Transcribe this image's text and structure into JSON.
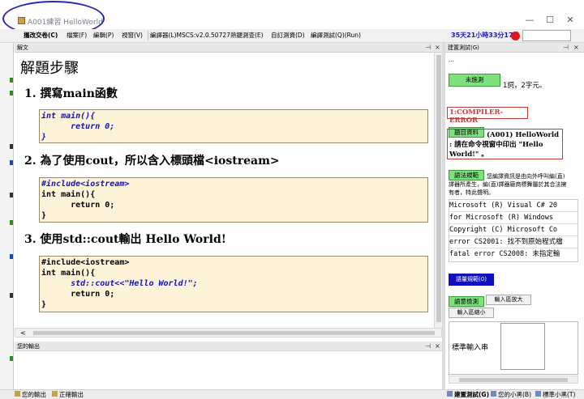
{
  "window": {
    "title": "A001練習 HelloWorld",
    "controls": [
      "—",
      "☐",
      "✕"
    ]
  },
  "menu": {
    "items": [
      "攜改交卷(C)",
      "檔案(F)",
      "編輯(P)",
      "視窗(V)",
      "編譯器(L)MSCS:v2.0.50727",
      "熱鍵測查(E)",
      "自訂測資(D)",
      "編譯測試(Q)(Run)"
    ],
    "timer": "35天21小時33分17秒"
  },
  "solution": {
    "pane_title": "解文",
    "heading": "解題步驟",
    "steps": [
      {
        "label": "1. 撰寫main函數"
      },
      {
        "label": "2. 為了使用cout，所以含入標頭檔<iostream>"
      },
      {
        "label": "3. 使用std::cout輸出 Hello World!"
      }
    ],
    "code1": [
      "int main(){",
      "      return 0;",
      "}"
    ],
    "code2": [
      "#include<iostream>",
      "int main(){",
      "      return 0;",
      "}"
    ],
    "code3": [
      "#include<iostream>",
      "int main(){",
      "      std::cout<<\"Hello World!\";",
      "      return 0;",
      "}"
    ]
  },
  "output_pane": {
    "title": "您的輸出"
  },
  "right": {
    "pane_title": "建置測試(G)",
    "small_button": "...",
    "status_button": "未施測",
    "word_count": "1詞，2字元。",
    "error_label": "1:COMPILER-ERROR",
    "problem_button": "題目資料",
    "problem_text": "(A001) HelloWorld : 請在命令視窗中印出 \"Hello World!\" 。",
    "law_button": "語法規範",
    "law_text": "您編譯資訊是由向外呼叫編(直)譯器所產生，編(直)譯器廠商標舞屬於其合法擁有者，特此聲明。",
    "compiler_lines": [
      "Microsoft (R) Visual C# 20",
      "for Microsoft (R) Windows",
      "Copyright (C) Microsoft Co",
      "error CS2001: 找不到原始程式檔",
      "fatal error CS2008: 未指定輸"
    ],
    "rules_button": "語量規範(0)",
    "check_button": "語意檢測",
    "zoom_in_button": "輸入區放大",
    "zoom_out_button": "輸入區縮小",
    "stdin_label": "標準輸入串"
  },
  "bottom_tabs": {
    "left": [
      "您的輸出",
      "正確輸出"
    ],
    "right": [
      "建置測試(G)",
      "您的小黑(B)",
      "標準小黑(T)"
    ]
  },
  "colors": {
    "title_ellipse": "#2a2ab0",
    "keyword": "#1414b4",
    "code_bg": "#fdf3d8",
    "green_button": "#7ee07e",
    "error_border": "#c83a3a",
    "rules_button": "#1010c0",
    "timer_dot": "#e01818"
  }
}
